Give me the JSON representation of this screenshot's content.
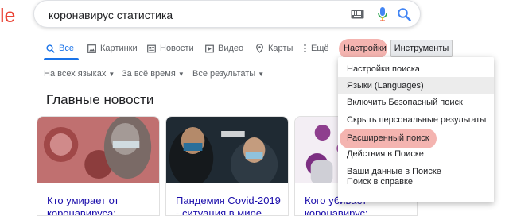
{
  "logo_fragment": "le",
  "search": {
    "query": "коронавирус статистика"
  },
  "tabs": [
    {
      "label": "Все",
      "icon": "search-icon"
    },
    {
      "label": "Картинки",
      "icon": "image-icon"
    },
    {
      "label": "Новости",
      "icon": "news-icon"
    },
    {
      "label": "Видео",
      "icon": "video-icon"
    },
    {
      "label": "Карты",
      "icon": "map-pin-icon"
    },
    {
      "label": "Ещё",
      "icon": "more-dots-icon"
    },
    {
      "label": "Настройки"
    }
  ],
  "tools_label": "Инструменты",
  "filters": [
    "На всех языках",
    "За всё время",
    "Все результаты"
  ],
  "section_title": "Главные новости",
  "cards": [
    {
      "title": "Кто умирает от коронавируса:"
    },
    {
      "title": "Пандемия Covid-2019 - ситуация в мире"
    },
    {
      "title": "Кого убивает коронавирус:"
    }
  ],
  "settings_menu": [
    "Настройки поиска",
    "Языки  (Languages)",
    "Включить Безопасный поиск",
    "Скрыть персональные результаты",
    "Расширенный поиск",
    "Действия в Поиске",
    "Ваши данные в Поиске",
    "Поиск в справке"
  ],
  "colors": {
    "accent": "#1a73e8",
    "link": "#1a0dab",
    "highlight": "#f2a7a2"
  }
}
